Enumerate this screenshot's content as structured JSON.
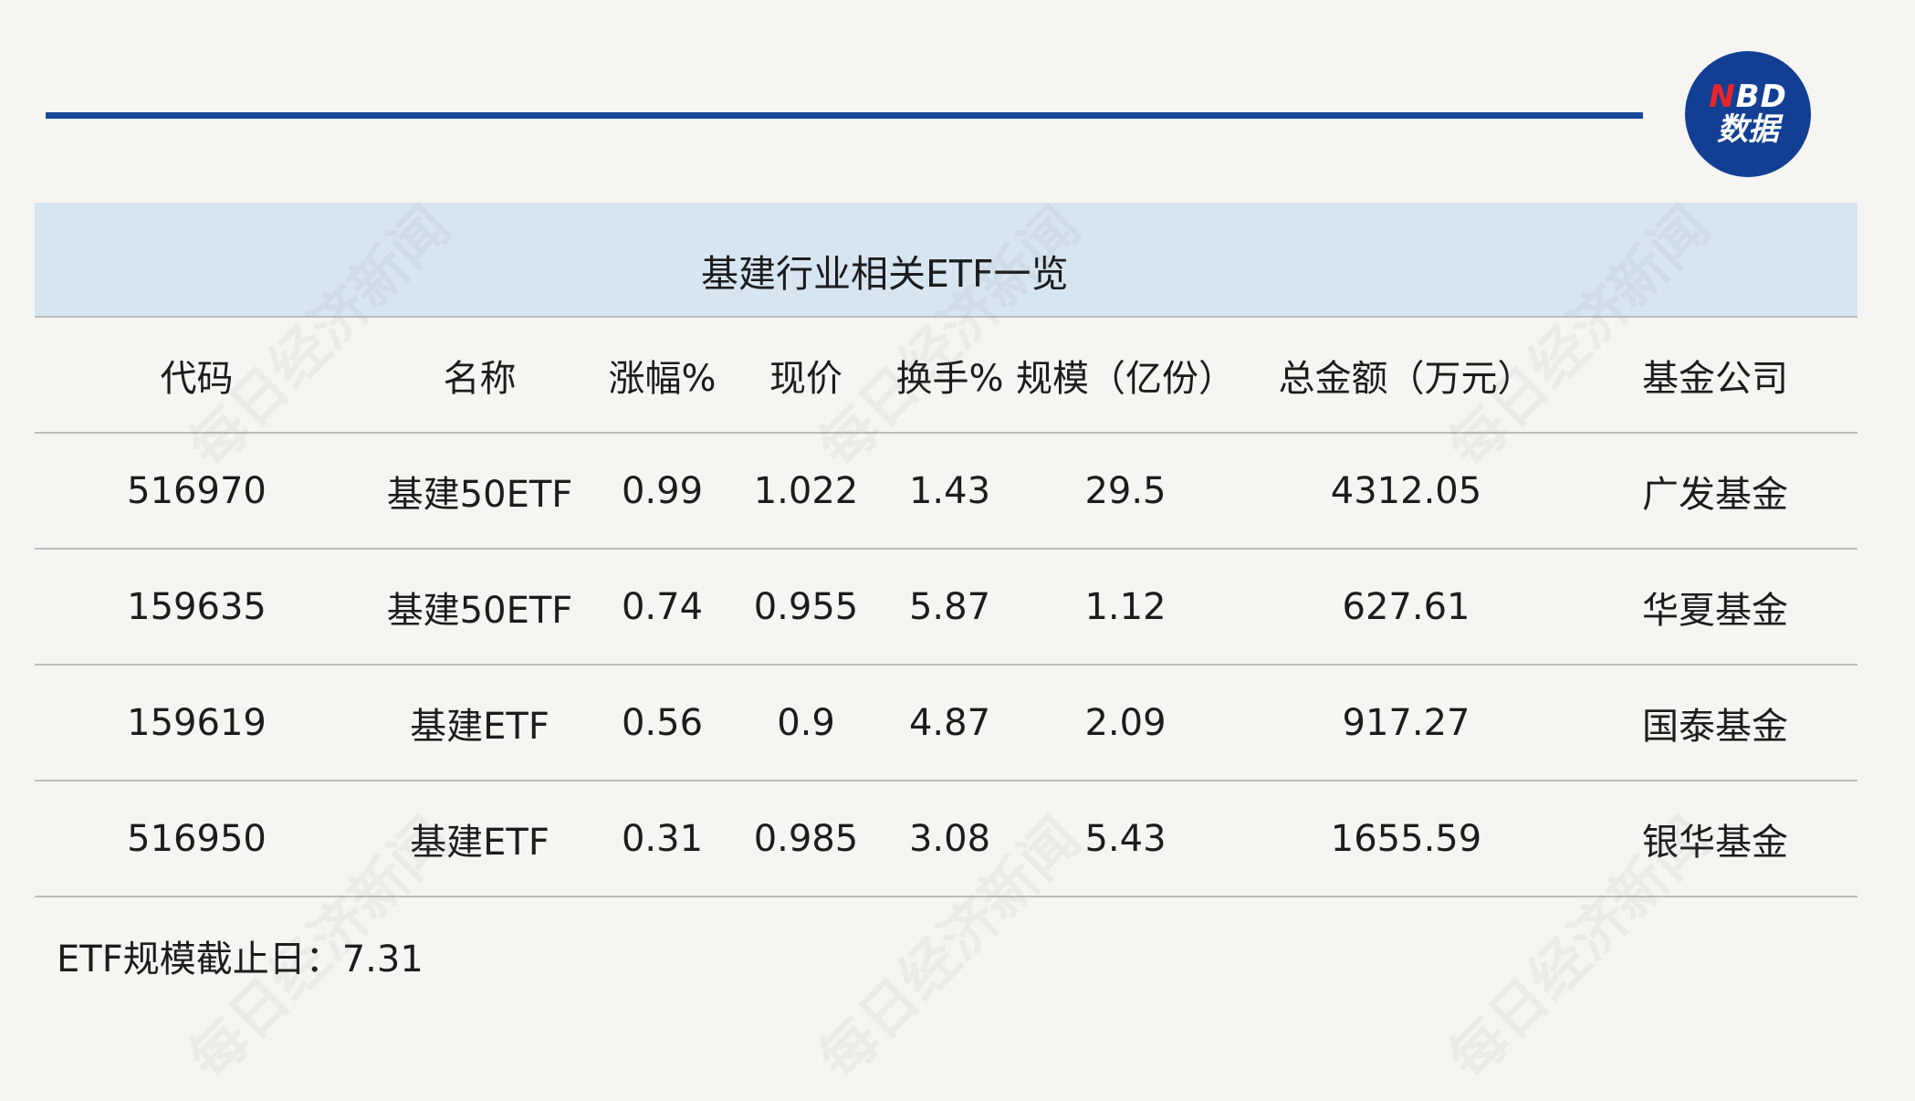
{
  "logo": {
    "line1_n": "N",
    "line1_rest": "BD",
    "line2": "数据"
  },
  "watermark": "每日经济新闻",
  "table_title": "基建行业相关ETF一览",
  "columns": [
    "代码",
    "名称",
    "涨幅%",
    "现价",
    "换手%",
    "规模（亿份）",
    "总金额（万元）",
    "基金公司"
  ],
  "rows": [
    [
      "516970",
      "基建50ETF",
      "0.99",
      "1.022",
      "1.43",
      "29.5",
      "4312.05",
      "广发基金"
    ],
    [
      "159635",
      "基建50ETF",
      "0.74",
      "0.955",
      "5.87",
      "1.12",
      "627.61",
      "华夏基金"
    ],
    [
      "159619",
      "基建ETF",
      "0.56",
      "0.9",
      "4.87",
      "2.09",
      "917.27",
      "国泰基金"
    ],
    [
      "516950",
      "基建ETF",
      "0.31",
      "0.985",
      "3.08",
      "5.43",
      "1655.59",
      "银华基金"
    ]
  ],
  "footnote": "ETF规模截止日：7.31",
  "colors": {
    "accent_rule": "#1a4898",
    "title_bg": "#d7e5f1",
    "logo_bg": "#123f94",
    "logo_n": "#e8252c"
  }
}
